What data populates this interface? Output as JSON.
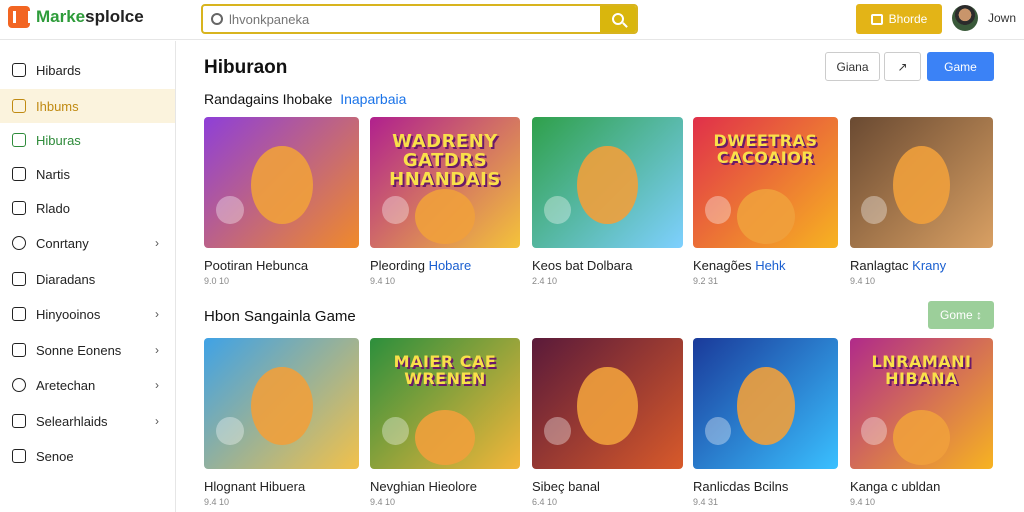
{
  "app": {
    "logo_text_prefix": "Marke",
    "logo_text_suffix": "splolce"
  },
  "search": {
    "placeholder": "lhvonkpaneka",
    "value": ""
  },
  "header": {
    "browse_label": "Bhorde",
    "user_name": "Jown"
  },
  "sidebar": {
    "items": [
      {
        "label": "Hibards",
        "icon": "home-icon",
        "chevron": false,
        "state": "normal"
      },
      {
        "label": "Ihbums",
        "icon": "album-icon",
        "chevron": false,
        "state": "active"
      },
      {
        "label": "Hiburas",
        "icon": "grid-icon",
        "chevron": false,
        "state": "green"
      },
      {
        "label": "Nartis",
        "icon": "check-icon",
        "chevron": false,
        "state": "normal"
      },
      {
        "label": "Rlado",
        "icon": "doc-icon",
        "chevron": false,
        "state": "normal"
      },
      {
        "label": "Conrtany",
        "icon": "settings-icon",
        "chevron": true,
        "state": "normal"
      },
      {
        "label": "Diaradans",
        "icon": "doc-icon",
        "chevron": false,
        "state": "normal"
      },
      {
        "label": "Hinyooinos",
        "icon": "square-icon",
        "chevron": true,
        "state": "normal"
      },
      {
        "label": "Sonne Eonens",
        "icon": "edit-icon",
        "chevron": true,
        "state": "normal"
      },
      {
        "label": "Aretechan",
        "icon": "clock-icon",
        "chevron": true,
        "state": "normal"
      },
      {
        "label": "Selearhlaids",
        "icon": "doc-icon",
        "chevron": true,
        "state": "normal"
      },
      {
        "label": "Senoe",
        "icon": "link-icon",
        "chevron": false,
        "state": "normal"
      }
    ]
  },
  "main": {
    "title": "Hiburaon",
    "share_label": "Giana",
    "more_label": "↗",
    "game_label": "Game",
    "section1": {
      "title": "Randagains Ihobake",
      "link": "Inaparbaia"
    },
    "section2": {
      "title": "Hbon Sangainla Game",
      "button_label": "Gome ↕"
    },
    "row1": [
      {
        "title": "Pootiran Hebunca",
        "title_blue": "",
        "meta": "9.0 10",
        "thumb_text": "",
        "colors": [
          "#8e3fd8",
          "#f08a2a"
        ]
      },
      {
        "title": "Pleording",
        "title_blue": "Hobare",
        "meta": "9.4 10",
        "thumb_text": "WADRENY GATDRS HNANDAIS",
        "colors": [
          "#b0208e",
          "#f4c33a"
        ]
      },
      {
        "title": "Keos bat Dolbara",
        "title_blue": "",
        "meta": "2.4 10",
        "thumb_text": "",
        "colors": [
          "#2fa04a",
          "#7ed0ff"
        ]
      },
      {
        "title": "Kenagões",
        "title_blue": "Hehk",
        "meta": "9.2 31",
        "thumb_text": "DWEETRAS CACOAIOR",
        "colors": [
          "#e0304a",
          "#f7b321"
        ]
      },
      {
        "title": "Ranlagtac",
        "title_blue": "Krany",
        "meta": "9.4 10",
        "thumb_text": "",
        "colors": [
          "#6a4a32",
          "#d9a063"
        ]
      }
    ],
    "row2": [
      {
        "title": "Hlognant Hibuera",
        "title_blue": "",
        "meta": "9.4 10",
        "thumb_text": "",
        "colors": [
          "#3fa2e6",
          "#f2c14a"
        ]
      },
      {
        "title": "Nevghian Hieolore",
        "title_blue": "",
        "meta": "9.4 10",
        "thumb_text": "MAIER CAE WRENEN",
        "colors": [
          "#2c8f3c",
          "#f4b63a"
        ]
      },
      {
        "title": "Sibeç banal",
        "title_blue": "",
        "meta": "6.4 10",
        "thumb_text": "",
        "colors": [
          "#5a1a3a",
          "#d85a2a"
        ]
      },
      {
        "title": "Ranlicdas Bcilns",
        "title_blue": "",
        "meta": "9.4 31",
        "thumb_text": "",
        "colors": [
          "#1a3a9a",
          "#3ac0ff"
        ]
      },
      {
        "title": "Kanga c ubldan",
        "title_blue": "",
        "meta": "9.4 10",
        "thumb_text": "LNRAMANI HIBANA",
        "colors": [
          "#b02a8a",
          "#f7b321"
        ]
      }
    ]
  },
  "colors": {
    "accent_yellow": "#e3b417",
    "primary_blue": "#3b82f6",
    "green": "#2e8b3a"
  }
}
